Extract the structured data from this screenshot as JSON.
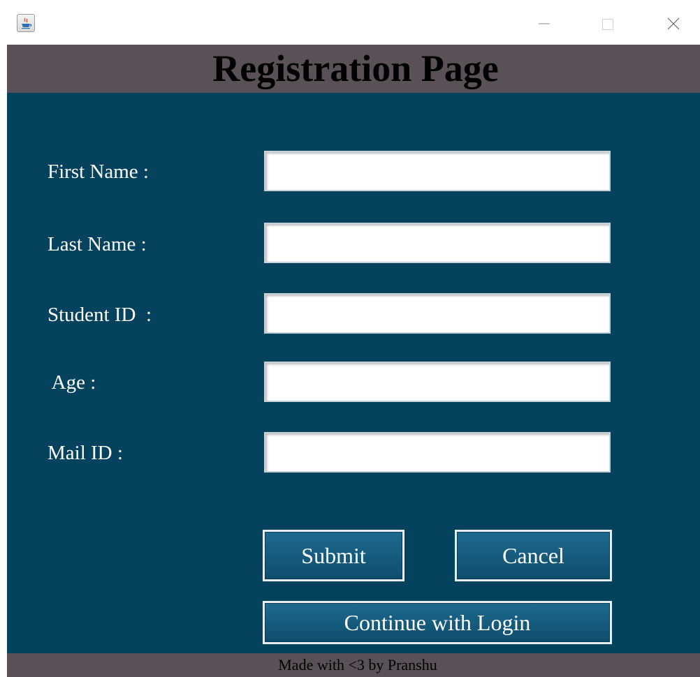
{
  "window": {
    "icons": {
      "app": "java-icon",
      "minimize": "minimize-icon",
      "maximize": "maximize-icon",
      "close": "close-icon"
    }
  },
  "header": {
    "title": "Registration Page"
  },
  "form": {
    "fields": [
      {
        "label": "First Name :",
        "value": "",
        "placeholder": ""
      },
      {
        "label": "Last Name :",
        "value": "",
        "placeholder": ""
      },
      {
        "label": "Student ID  :",
        "value": "",
        "placeholder": ""
      },
      {
        "label": " Age :",
        "value": "",
        "placeholder": ""
      },
      {
        "label": "Mail ID :",
        "value": "",
        "placeholder": ""
      }
    ]
  },
  "buttons": {
    "submit": "Submit",
    "cancel": "Cancel",
    "login": "Continue with Login"
  },
  "footer": {
    "text": "Made with <3 by Pranshu"
  },
  "colors": {
    "background": "#04425e",
    "header_bar": "#5a5057",
    "button": "#155a7c",
    "label_text": "#ffffff"
  }
}
